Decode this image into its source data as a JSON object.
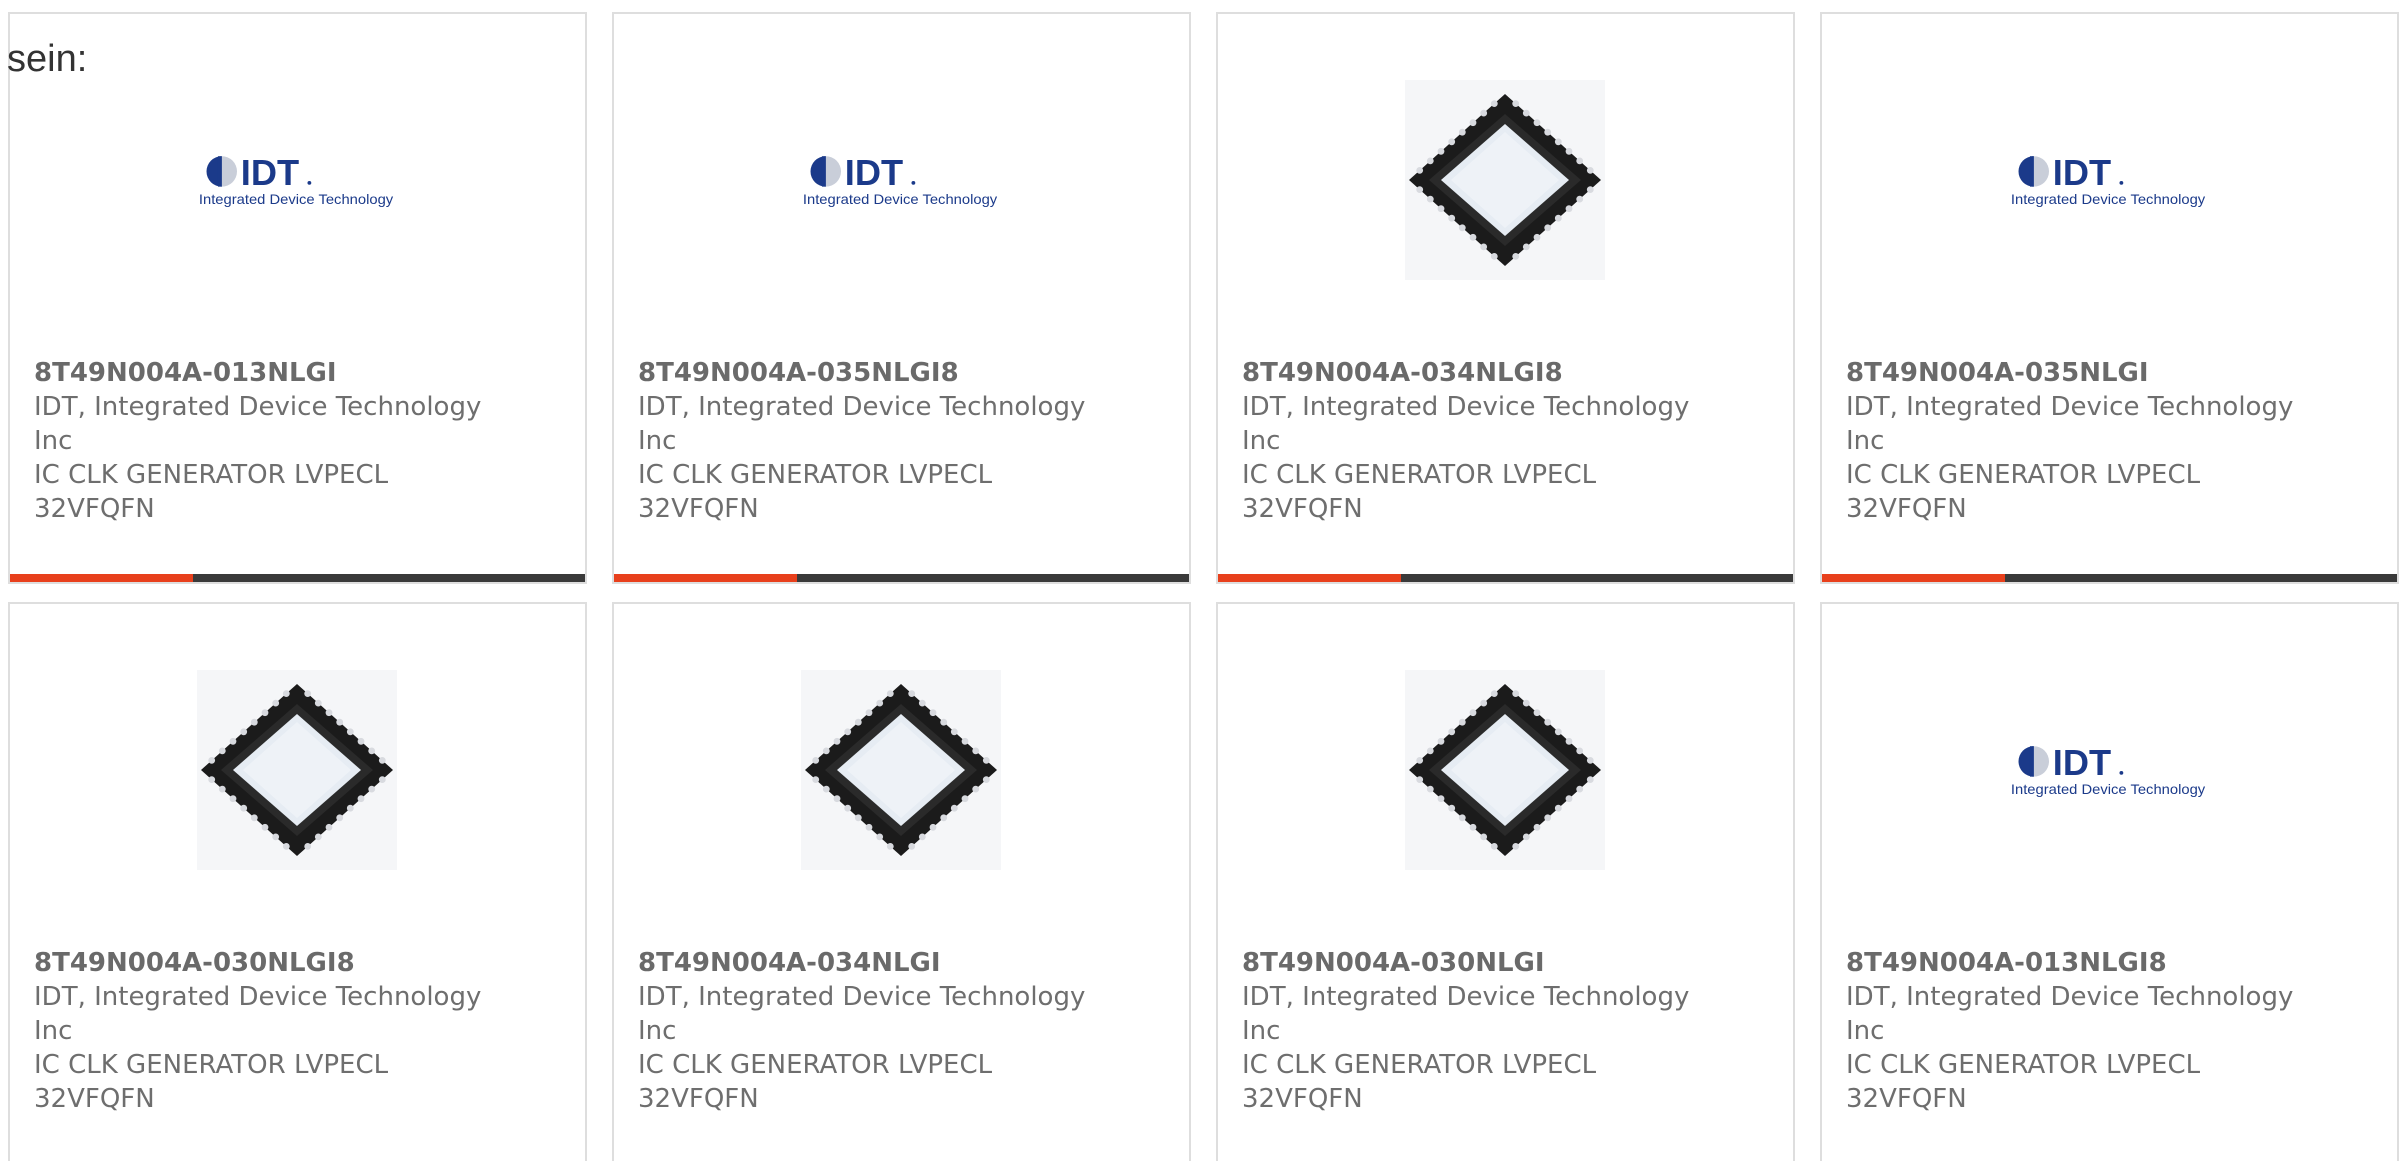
{
  "intro_text": "sein:",
  "colors": {
    "card_border": "#dedede",
    "text": "#6e6e6e",
    "bar_dark": "#3a3a3a",
    "bar_accent": "#e8401c"
  },
  "logo": {
    "mark": "IDT",
    "tagline": "Integrated Device Technology"
  },
  "products": [
    {
      "part_number": "8T49N004A-013NLGI",
      "manufacturer": "IDT, Integrated Device Technology Inc",
      "description": "IC CLK GENERATOR LVPECL 32VFQFN",
      "image": "idt-logo-icon"
    },
    {
      "part_number": "8T49N004A-035NLGI8",
      "manufacturer": "IDT, Integrated Device Technology Inc",
      "description": "IC CLK GENERATOR LVPECL 32VFQFN",
      "image": "idt-logo-icon"
    },
    {
      "part_number": "8T49N004A-034NLGI8",
      "manufacturer": "IDT, Integrated Device Technology Inc",
      "description": "IC CLK GENERATOR LVPECL 32VFQFN",
      "image": "qfn-chip-icon"
    },
    {
      "part_number": "8T49N004A-035NLGI",
      "manufacturer": "IDT, Integrated Device Technology Inc",
      "description": "IC CLK GENERATOR LVPECL 32VFQFN",
      "image": "idt-logo-icon"
    },
    {
      "part_number": "8T49N004A-030NLGI8",
      "manufacturer": "IDT, Integrated Device Technology Inc",
      "description": "IC CLK GENERATOR LVPECL 32VFQFN",
      "image": "qfn-chip-icon"
    },
    {
      "part_number": "8T49N004A-034NLGI",
      "manufacturer": "IDT, Integrated Device Technology Inc",
      "description": "IC CLK GENERATOR LVPECL 32VFQFN",
      "image": "qfn-chip-icon"
    },
    {
      "part_number": "8T49N004A-030NLGI",
      "manufacturer": "IDT, Integrated Device Technology Inc",
      "description": "IC CLK GENERATOR LVPECL 32VFQFN",
      "image": "qfn-chip-icon"
    },
    {
      "part_number": "8T49N004A-013NLGI8",
      "manufacturer": "IDT, Integrated Device Technology Inc",
      "description": "IC CLK GENERATOR LVPECL 32VFQFN",
      "image": "idt-logo-icon"
    }
  ]
}
